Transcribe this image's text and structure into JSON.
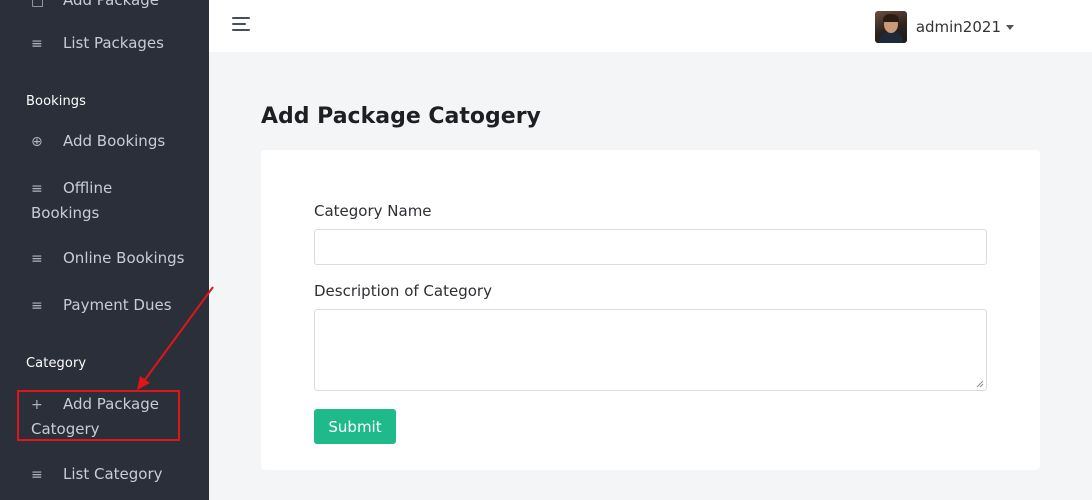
{
  "sidebar": {
    "items_top": [
      {
        "icon": "square-icon",
        "glyph": "□",
        "label": "Add Package"
      },
      {
        "icon": "list-icon",
        "glyph": "≡",
        "label": "List Packages"
      }
    ],
    "bookings_section": "Bookings",
    "bookings": [
      {
        "icon": "plus-circle-icon",
        "glyph": "⊕",
        "label": "Add Bookings"
      },
      {
        "icon": "list-icon",
        "glyph": "≡",
        "label": "Offline",
        "label2": "Bookings"
      },
      {
        "icon": "list-icon",
        "glyph": "≡",
        "label": "Online Bookings"
      },
      {
        "icon": "list-icon",
        "glyph": "≡",
        "label": "Payment Dues"
      }
    ],
    "category_section": "Category",
    "category": [
      {
        "icon": "plus-icon",
        "glyph": "+",
        "label": "Add Package",
        "label2": "Catogery"
      },
      {
        "icon": "list-icon",
        "glyph": "≡",
        "label": "List Category"
      }
    ]
  },
  "header": {
    "username": "admin2021"
  },
  "main": {
    "title": "Add Package Catogery",
    "form": {
      "category_name_label": "Category Name",
      "category_name_value": "",
      "description_label": "Description of Category",
      "description_value": "",
      "submit_label": "Submit"
    }
  },
  "colors": {
    "sidebar_bg": "#2a2f39",
    "submit_bg": "#1fba8a",
    "highlight": "#e01616"
  }
}
